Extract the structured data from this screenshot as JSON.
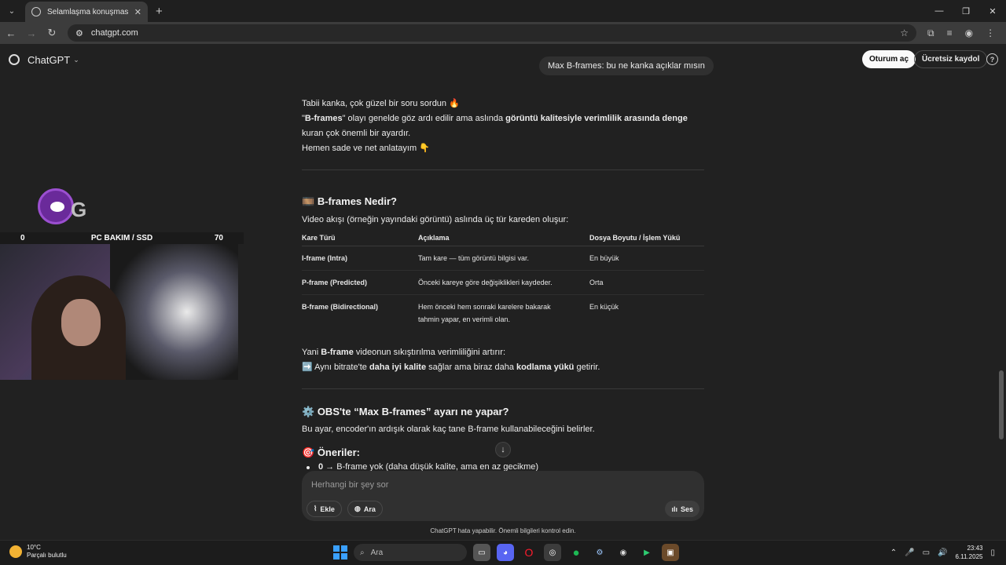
{
  "browser": {
    "tab_title": "Selamlaşma konuşması",
    "url": "chatgpt.com"
  },
  "header": {
    "brand": "ChatGPT",
    "login": "Oturum aç",
    "signup": "Ücretsiz kaydol",
    "help": "?"
  },
  "user_message": "Max B-frames: bu ne kanka açıklar mısın",
  "intro": {
    "line1": "Tabii kanka, çok güzel bir soru sordun 🔥",
    "line2_a": "\"",
    "line2_b": "B-frames",
    "line2_c": "\" olayı genelde göz ardı edilir ama aslında ",
    "line2_d": "görüntü kalitesiyle verimlilik arasında denge",
    "line2_e": " kuran çok önemli bir ayardır.",
    "line3": "Hemen sade ve net anlatayım 👇"
  },
  "section1": {
    "icon": "🎞️",
    "title": "B-frames Nedir?",
    "lead": "Video akışı (örneğin yayındaki görüntü) aslında üç tür kareden oluşur:",
    "headers": [
      "Kare Türü",
      "Açıklama",
      "Dosya Boyutu / İşlem Yükü"
    ],
    "rows": [
      [
        "I-frame (Intra)",
        "Tam kare — tüm görüntü bilgisi var.",
        "En büyük"
      ],
      [
        "P-frame (Predicted)",
        "Önceki kareye göre değişiklikleri kaydeder.",
        "Orta"
      ],
      [
        "B-frame (Bidirectional)",
        "Hem önceki hem sonraki karelere bakarak tahmin yapar, en verimli olan.",
        "En küçük"
      ]
    ],
    "sum_a": "Yani ",
    "sum_b": "B-frame",
    "sum_c": " videonun sıkıştırılma verimliliğini artırır:",
    "arrow": "➡️",
    "sum2_a": " Aynı bitrate'te ",
    "sum2_b": "daha iyi kalite",
    "sum2_c": " sağlar ama biraz daha ",
    "sum2_d": "kodlama yükü",
    "sum2_e": " getirir."
  },
  "section2": {
    "icon": "⚙️",
    "title": "OBS'te “Max B-frames” ayarı ne yapar?",
    "lead": "Bu ayar, encoder'ın ardışık olarak kaç tane B-frame kullanabileceğini belirler.",
    "rec_icon": "🎯",
    "rec_title": "Öneriler:",
    "rec1_a": "0",
    "rec1_b": " → B-frame yok (daha düşük kalite, ama en az gecikme)"
  },
  "composer": {
    "placeholder": "Herhangi bir şey sor",
    "attach": "Ekle",
    "search": "Ara",
    "voice": "Ses"
  },
  "disclaimer": "ChatGPT hata yapabilir. Önemli bilgileri kontrol edin.",
  "overlay": {
    "brand_text": "G",
    "left_num": "0",
    "title": "PC BAKIM / SSD",
    "right_num": "70"
  },
  "taskbar": {
    "temp": "10°C",
    "weather": "Parçalı bulutlu",
    "search": "Ara",
    "time": "23:43",
    "date": "6.11.2025"
  }
}
